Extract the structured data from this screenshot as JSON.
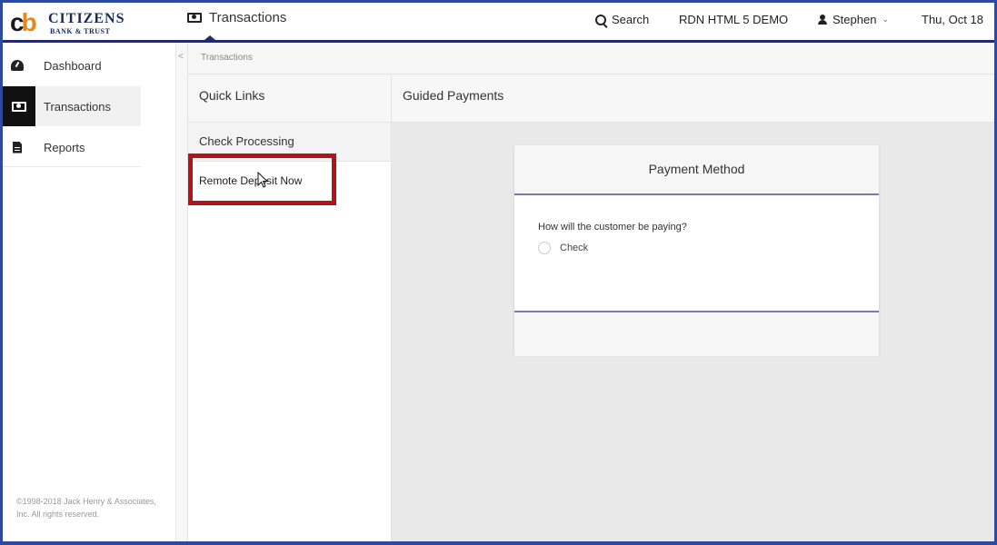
{
  "brand": {
    "logo_mark_c": "c",
    "logo_mark_b": "b",
    "name_line1": "Citizens",
    "name_line2": "Bank & Trust"
  },
  "header": {
    "module_title": "Transactions",
    "search_label": "Search",
    "environment": "RDN HTML 5 DEMO",
    "user_name": "Stephen",
    "date": "Thu, Oct 18",
    "accent_color": "#24286e"
  },
  "sidebar": {
    "items": [
      {
        "label": "Dashboard",
        "icon": "dashboard-icon"
      },
      {
        "label": "Transactions",
        "icon": "cash-icon"
      },
      {
        "label": "Reports",
        "icon": "document-icon"
      }
    ],
    "collapse_glyph": "<",
    "copyright": "©1998-2018 Jack Henry & Associates, Inc. All rights reserved."
  },
  "breadcrumb": {
    "current": "Transactions"
  },
  "quick_links": {
    "title": "Quick Links",
    "items": [
      {
        "label": "Check Processing"
      },
      {
        "label": "Remote Deposit Now"
      }
    ],
    "highlight_color": "#b3141b"
  },
  "main": {
    "title": "Guided Payments",
    "card": {
      "title": "Payment Method",
      "question": "How will the customer be paying?",
      "options": [
        {
          "label": "Check",
          "selected": false
        }
      ]
    }
  }
}
